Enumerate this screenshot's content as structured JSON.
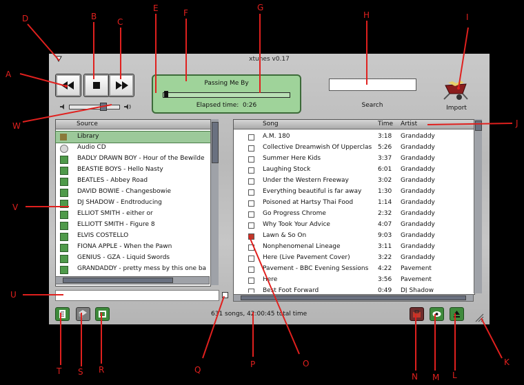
{
  "app": {
    "title": "xtunes v0.17"
  },
  "now_playing": {
    "title": "Passing Me By",
    "elapsed_label": "Elapsed time:",
    "elapsed": "0:26"
  },
  "search": {
    "label": "Search",
    "value": ""
  },
  "import": {
    "label": "Import"
  },
  "source": {
    "header": "Source",
    "items": [
      "Library",
      "Audio CD",
      "BADLY DRAWN BOY - Hour of the Bewilde",
      "BEASTIE BOYS - Hello Nasty",
      "BEATLES - Abbey Road",
      "DAVID BOWIE - Changesbowie",
      "DJ SHADOW - Endtroducing",
      "ELLIOT SMITH - either or",
      "ELLIOTT SMITH - Figure 8",
      "ELVIS COSTELLO",
      "FIONA APPLE - When the Pawn",
      "GENIUS - GZA - Liquid Swords",
      "GRANDADDY - pretty mess by this one ba"
    ]
  },
  "songs": {
    "headers": {
      "song": "Song",
      "time": "Time",
      "artist": "Artist"
    },
    "rows": [
      {
        "song": "A.M. 180",
        "time": "3:18",
        "artist": "Grandaddy"
      },
      {
        "song": "Collective Dreamwish Of Upperclas",
        "time": "5:26",
        "artist": "Grandaddy"
      },
      {
        "song": "Summer Here Kids",
        "time": "3:37",
        "artist": "Grandaddy"
      },
      {
        "song": "Laughing Stock",
        "time": "6:01",
        "artist": "Grandaddy"
      },
      {
        "song": "Under the Western Freeway",
        "time": "3:02",
        "artist": "Grandaddy"
      },
      {
        "song": "Everything beautiful is far away",
        "time": "1:30",
        "artist": "Grandaddy"
      },
      {
        "song": "Poisoned at Hartsy Thai Food",
        "time": "1:14",
        "artist": "Grandaddy"
      },
      {
        "song": "Go Progress Chrome",
        "time": "2:32",
        "artist": "Grandaddy"
      },
      {
        "song": "Why Took Your Advice",
        "time": "4:07",
        "artist": "Grandaddy"
      },
      {
        "song": "Lawn & So On",
        "time": "9:03",
        "artist": "Grandaddy"
      },
      {
        "song": "Nonphenomenal Lineage",
        "time": "3:11",
        "artist": "Grandaddy"
      },
      {
        "song": "Here (Live Pavement Cover)",
        "time": "3:22",
        "artist": "Grandaddy"
      },
      {
        "song": "Pavement - BBC Evening Sessions",
        "time": "4:22",
        "artist": "Pavement"
      },
      {
        "song": "Here",
        "time": "3:56",
        "artist": "Pavement"
      },
      {
        "song": "Best Foot Forward",
        "time": "0:49",
        "artist": "DJ Shadow"
      }
    ]
  },
  "status": {
    "text": "631 songs, 42:00:45 total time"
  },
  "callouts": [
    "A",
    "B",
    "C",
    "D",
    "E",
    "F",
    "G",
    "H",
    "I",
    "J",
    "K",
    "L",
    "M",
    "N",
    "O",
    "P",
    "Q",
    "R",
    "S",
    "T",
    "U",
    "V",
    "W"
  ],
  "colors": {
    "display_bg": "#9fd39a",
    "selected_row": "#9cc99a",
    "callout": "#e0201e",
    "icon_green": "#3f8a3c"
  }
}
